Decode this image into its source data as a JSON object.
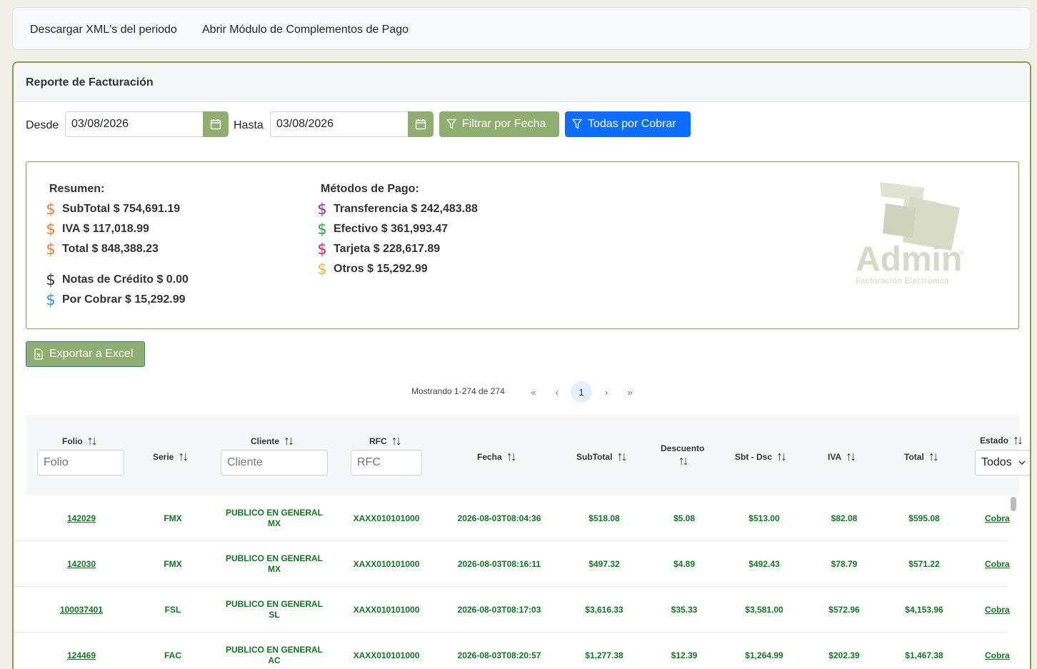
{
  "topbar": {
    "link1": "Descargar XML's del periodo",
    "link2": "Abrir Módulo de Complementos de Pago"
  },
  "report": {
    "title": "Reporte de Facturación",
    "desde_label": "Desde",
    "desde_value": "03/08/2026",
    "hasta_label": "Hasta",
    "hasta_value": "03/08/2026",
    "filter_btn": "Filtrar por Fecha",
    "todas_btn": "Todas por Cobrar"
  },
  "summary": {
    "resumen_title": "Resumen:",
    "subtotal": "SubTotal $ 754,691.19",
    "iva": "IVA $ 117,018.99",
    "total": "Total $ 848,388.23",
    "notas": "Notas de Crédito $ 0.00",
    "por_cobrar": "Por Cobrar $ 15,292.99",
    "metodos_title": "Métodos de Pago:",
    "transferencia": "Transferencia $ 242,483.88",
    "efectivo": "Efectivo $ 361,993.47",
    "tarjeta": "Tarjeta $ 228,617.89",
    "otros": "Otros $ 15,292.99",
    "dollar": "$",
    "colors": {
      "orange": "#f47c2c",
      "dark": "#333333",
      "blue": "#2196f3",
      "purple": "#9c27b0",
      "green": "#28a745",
      "pink": "#e91e63",
      "yellow": "#fbb034"
    }
  },
  "logo": {
    "word": "Admin",
    "sub": "Facturación Electrónica",
    "mark": "®"
  },
  "export_btn": "Exportar a Excel",
  "pager": {
    "text": "Mostrando 1-274 de 274",
    "first": "«",
    "prev": "‹",
    "page": "1",
    "next": "›",
    "last": "»"
  },
  "table": {
    "headers": {
      "folio": "Folio",
      "serie": "Serie",
      "cliente": "Cliente",
      "rfc": "RFC",
      "fecha": "Fecha",
      "subtotal": "SubTotal",
      "descuento": "Descuento",
      "sbt_dsc": "Sbt - Dsc",
      "iva": "IVA",
      "total": "Total",
      "estado": "Estado"
    },
    "sort_icon": "↑↓",
    "filters": {
      "folio_ph": "Folio",
      "cliente_ph": "Cliente",
      "rfc_ph": "RFC",
      "estado_value": "Todos"
    },
    "rows": [
      {
        "folio": "142029",
        "serie": "FMX",
        "cliente1": "PUBLICO EN GENERAL",
        "cliente2": "MX",
        "rfc": "XAXX010101000",
        "fecha": "2026-08-03T08:04:36",
        "subtotal": "$518.08",
        "descuento": "$5.08",
        "sbt": "$513.00",
        "iva": "$82.08",
        "total": "$595.08",
        "estado": "Cobra"
      },
      {
        "folio": "142030",
        "serie": "FMX",
        "cliente1": "PUBLICO EN GENERAL",
        "cliente2": "MX",
        "rfc": "XAXX010101000",
        "fecha": "2026-08-03T08:16:11",
        "subtotal": "$497.32",
        "descuento": "$4.89",
        "sbt": "$492.43",
        "iva": "$78.79",
        "total": "$571.22",
        "estado": "Cobra"
      },
      {
        "folio": "100037401",
        "serie": "FSL",
        "cliente1": "PUBLICO EN GENERAL",
        "cliente2": "SL",
        "rfc": "XAXX010101000",
        "fecha": "2026-08-03T08:17:03",
        "subtotal": "$3,616.33",
        "descuento": "$35.33",
        "sbt": "$3,581.00",
        "iva": "$572.96",
        "total": "$4,153.96",
        "estado": "Cobra"
      },
      {
        "folio": "124469",
        "serie": "FAC",
        "cliente1": "PUBLICO EN GENERAL",
        "cliente2": "AC",
        "rfc": "XAXX010101000",
        "fecha": "2026-08-03T08:20:57",
        "subtotal": "$1,277.38",
        "descuento": "$12.39",
        "sbt": "$1,264.99",
        "iva": "$202.39",
        "total": "$1,467.38",
        "estado": "Cobra"
      }
    ]
  }
}
